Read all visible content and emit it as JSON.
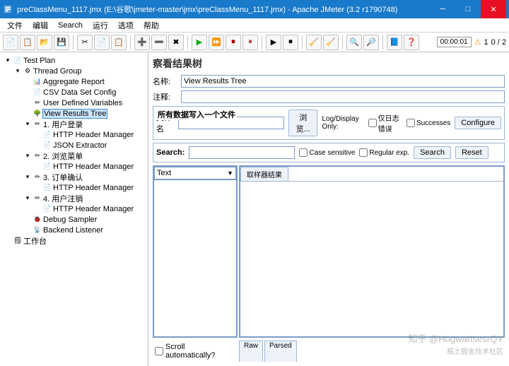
{
  "window": {
    "title": "preClassMenu_1117.jmx (E:\\谷歌\\jmeter-master\\jmx\\preClassMenu_1117.jmx) - Apache JMeter (3.2 r1790748)"
  },
  "menubar": [
    "文件",
    "编辑",
    "Search",
    "运行",
    "选项",
    "帮助"
  ],
  "toolbar_time": "00:00:01",
  "toolbar_warn": "1",
  "toolbar_count": "0 / 2",
  "tree": [
    {
      "depth": 0,
      "toggle": "▾",
      "icon": "📄",
      "label": "Test Plan",
      "sel": false
    },
    {
      "depth": 1,
      "toggle": "▾",
      "icon": "⚙",
      "label": "Thread Group",
      "sel": false
    },
    {
      "depth": 2,
      "toggle": "",
      "icon": "📊",
      "label": "Aggregate Report",
      "sel": false
    },
    {
      "depth": 2,
      "toggle": "",
      "icon": "📄",
      "label": "CSV Data Set Config",
      "sel": false
    },
    {
      "depth": 2,
      "toggle": "",
      "icon": "✏",
      "label": "User Defined Variables",
      "sel": false
    },
    {
      "depth": 2,
      "toggle": "",
      "icon": "🌳",
      "label": "View Results Tree",
      "sel": true
    },
    {
      "depth": 2,
      "toggle": "▾",
      "icon": "✏",
      "label": "1. 用户登录",
      "sel": false
    },
    {
      "depth": 3,
      "toggle": "",
      "icon": "📄",
      "label": "HTTP Header Manager",
      "sel": false
    },
    {
      "depth": 3,
      "toggle": "",
      "icon": "📄",
      "label": "JSON Extractor",
      "sel": false
    },
    {
      "depth": 2,
      "toggle": "▾",
      "icon": "✏",
      "label": "2. 浏览菜单",
      "sel": false
    },
    {
      "depth": 3,
      "toggle": "",
      "icon": "📄",
      "label": "HTTP Header Manager",
      "sel": false
    },
    {
      "depth": 2,
      "toggle": "▾",
      "icon": "✏",
      "label": "3. 订单确认",
      "sel": false
    },
    {
      "depth": 3,
      "toggle": "",
      "icon": "📄",
      "label": "HTTP Header Manager",
      "sel": false
    },
    {
      "depth": 2,
      "toggle": "▾",
      "icon": "✏",
      "label": "4. 用户注销",
      "sel": false
    },
    {
      "depth": 3,
      "toggle": "",
      "icon": "📄",
      "label": "HTTP Header Manager",
      "sel": false
    },
    {
      "depth": 2,
      "toggle": "",
      "icon": "🐞",
      "label": "Debug Sampler",
      "sel": false
    },
    {
      "depth": 2,
      "toggle": "",
      "icon": "📡",
      "label": "Backend Listener",
      "sel": false
    },
    {
      "depth": 0,
      "toggle": "",
      "icon": "🗒",
      "label": "工作台",
      "sel": false
    }
  ],
  "panel": {
    "title": "察看结果树",
    "name_label": "名称:",
    "name_value": "View Results Tree",
    "comment_label": "注释:",
    "file_group_title": "所有数据写入一个文件",
    "filename_label": "文件名",
    "browse_btn": "浏览...",
    "logdisplay_label": "Log/Display Only:",
    "errors_cb": "仅日志错误",
    "successes_cb": "Successes",
    "configure_btn": "Configure",
    "search_label": "Search:",
    "case_cb": "Case sensitive",
    "regex_cb": "Regular exp.",
    "search_btn": "Search",
    "reset_btn": "Reset",
    "combo_value": "Text",
    "result_tab": "取样器结果",
    "scroll_cb": "Scroll automatically?",
    "raw_tab": "Raw",
    "parsed_tab": "Parsed"
  },
  "watermark": "知乎 @HogwartsesrQY",
  "watermark2": "稿土掘金技术社区"
}
